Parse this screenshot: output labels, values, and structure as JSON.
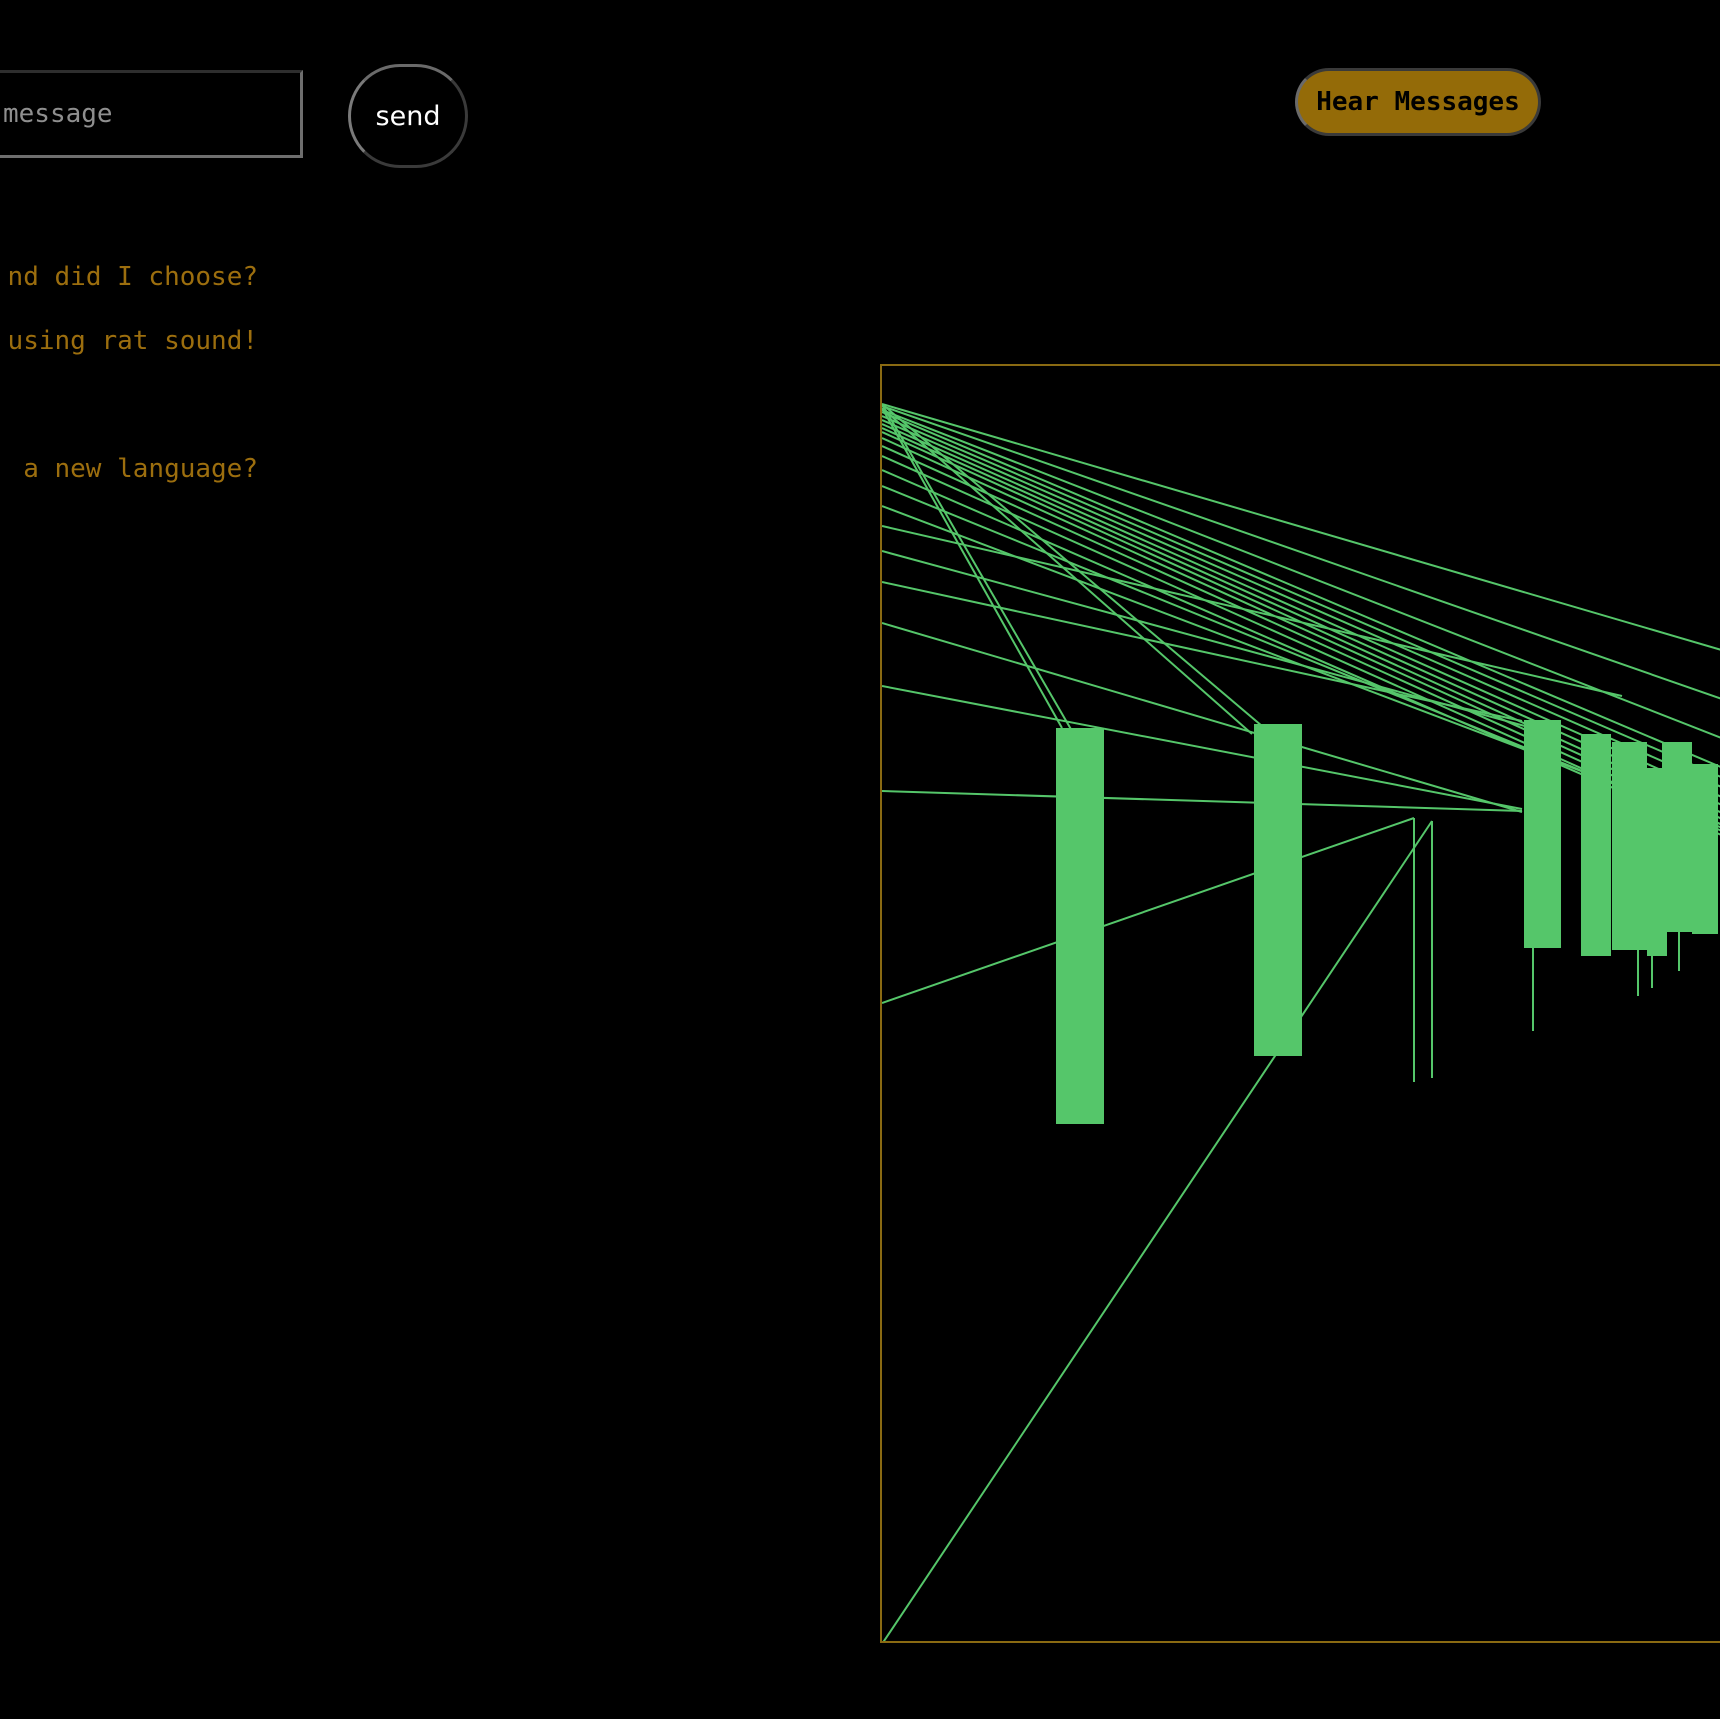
{
  "composer": {
    "input_placeholder": "message",
    "input_value": "",
    "send_label": "send"
  },
  "header": {
    "hear_label": "Hear Messages"
  },
  "messages": [
    "nd did I choose?",
    "using rat sound!",
    "",
    "a new language?"
  ],
  "colors": {
    "background": "#000000",
    "message_text": "#9c6e0e",
    "hear_button": "#946b08",
    "visualizer_border": "#8a6a12",
    "visualizer_stroke": "#55c66a"
  }
}
